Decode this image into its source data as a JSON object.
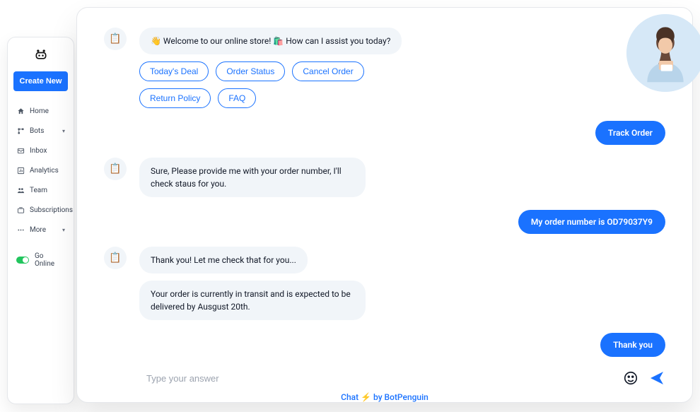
{
  "sidebar": {
    "create_label": "Create New",
    "items": [
      {
        "label": "Home",
        "expandable": false
      },
      {
        "label": "Bots",
        "expandable": true
      },
      {
        "label": "Inbox",
        "expandable": false
      },
      {
        "label": "Analytics",
        "expandable": false
      },
      {
        "label": "Team",
        "expandable": false
      },
      {
        "label": "Subscriptions",
        "expandable": false
      },
      {
        "label": "More",
        "expandable": true
      }
    ],
    "go_online_label": "Go Online"
  },
  "chat": {
    "bot_welcome": "👋 Welcome to our online store! 🛍️ How can I assist you today?",
    "chips": [
      "Today's Deal",
      "Order Status",
      "Cancel Order",
      "Return Policy",
      "FAQ"
    ],
    "user_msg_1": "Track Order",
    "bot_msg_2": "Sure, Please provide me with your order number, I'll check staus for you.",
    "user_msg_2": "My order number is  OD79037Y9",
    "bot_msg_3": "Thank you! Let me check that for you...",
    "bot_msg_4": "Your order is currently in transit and is expected to be delivered by Ausgust 20th.",
    "user_msg_3": "Thank you",
    "input_placeholder": "Type your answer",
    "footer": "Chat ⚡ by BotPenguin"
  }
}
